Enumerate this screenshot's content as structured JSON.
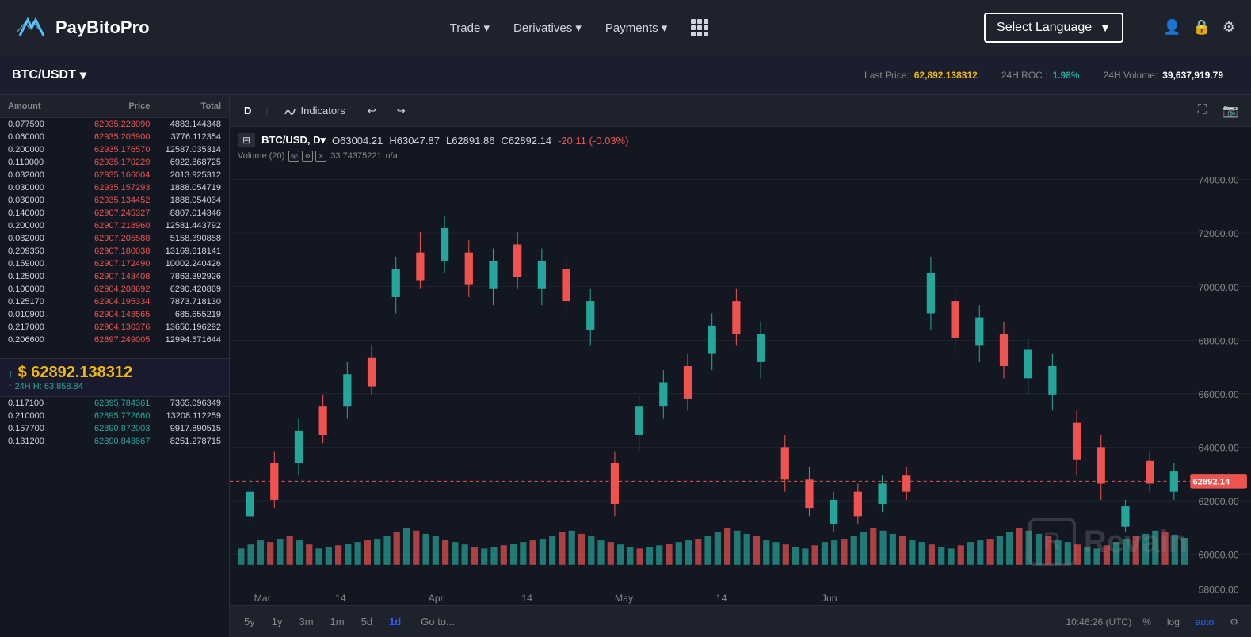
{
  "header": {
    "logo_text": "PayBitoPro",
    "nav": [
      {
        "label": "Trade ▾",
        "id": "trade"
      },
      {
        "label": "Derivatives ▾",
        "id": "derivatives"
      },
      {
        "label": "Payments ▾",
        "id": "payments"
      }
    ],
    "lang_button": "Select Language",
    "icons": [
      "👤",
      "🔒",
      "⚙"
    ]
  },
  "market_bar": {
    "pair": "BTC/USDT",
    "last_price_label": "Last Price:",
    "last_price": "62,892.138312",
    "roc_label": "24H ROC :",
    "roc_value": "1.98%",
    "volume_label": "24H Volume:",
    "volume_value": "39,637,919.79"
  },
  "chart": {
    "toolbar": {
      "timeframe": "D",
      "indicators": "Indicators",
      "undo": "↩",
      "redo": "↪"
    },
    "pair_info": {
      "symbol": "BTC/USD, D▾",
      "open_label": "O",
      "open_val": "63004.21",
      "high_label": "H",
      "high_val": "63047.87",
      "low_label": "L",
      "low_val": "62891.86",
      "close_label": "C",
      "close_val": "62892.14",
      "change": "-20.11 (-0.03%)"
    },
    "volume_info": {
      "label": "Volume (20)",
      "value": "33.74375221",
      "extra": "n/a"
    },
    "price_label": "62892.14",
    "price_levels": [
      "74000.00",
      "72000.00",
      "70000.00",
      "68000.00",
      "66000.00",
      "64000.00",
      "62000.00",
      "60000.00",
      "58000.00"
    ],
    "time_labels": [
      "Mar",
      "14",
      "Apr",
      "14",
      "May",
      "14",
      "Jun"
    ],
    "bottom_time": "10:46:26 (UTC)",
    "timeframes": [
      "5y",
      "1y",
      "3m",
      "1m",
      "5d",
      "1d"
    ],
    "goto": "Go to...",
    "right_controls": [
      "%",
      "log",
      "auto",
      "⚙"
    ]
  },
  "order_book": {
    "headers": [
      "Amount",
      "Price",
      "Total"
    ],
    "sell_rows": [
      {
        "amount": "0.077590",
        "price": "62935.228090",
        "total": "4883.144348"
      },
      {
        "amount": "0.060000",
        "price": "62935.205900",
        "total": "3776.112354"
      },
      {
        "amount": "0.200000",
        "price": "62935.176570",
        "total": "12587.035314"
      },
      {
        "amount": "0.110000",
        "price": "62935.170229",
        "total": "6922.868725"
      },
      {
        "amount": "0.032000",
        "price": "62935.166004",
        "total": "2013.925312"
      },
      {
        "amount": "0.030000",
        "price": "62935.157293",
        "total": "1888.054719"
      },
      {
        "amount": "0.030000",
        "price": "62935.134452",
        "total": "1888.054034"
      },
      {
        "amount": "0.140000",
        "price": "62907.245327",
        "total": "8807.014346"
      },
      {
        "amount": "0.200000",
        "price": "62907.218960",
        "total": "12581.443792"
      },
      {
        "amount": "0.082000",
        "price": "62907.205588",
        "total": "5158.390858"
      },
      {
        "amount": "0.209350",
        "price": "62907.180038",
        "total": "13169.618141"
      },
      {
        "amount": "0.159000",
        "price": "62907.172490",
        "total": "10002.240426"
      },
      {
        "amount": "0.125000",
        "price": "62907.143408",
        "total": "7863.392926"
      },
      {
        "amount": "0.100000",
        "price": "62904.208692",
        "total": "6290.420869"
      },
      {
        "amount": "0.125170",
        "price": "62904.195334",
        "total": "7873.718130"
      },
      {
        "amount": "0.010900",
        "price": "62904.148565",
        "total": "685.655219"
      },
      {
        "amount": "0.217000",
        "price": "62904.130376",
        "total": "13650.196292"
      },
      {
        "amount": "0.206600",
        "price": "62897.249005",
        "total": "12994.571644"
      }
    ],
    "current_price": "$ 62892.138312",
    "price_arrow": "↑",
    "price_high": "24H H: 63,858.84",
    "buy_rows": [
      {
        "amount": "0.117100",
        "price": "62895.784361",
        "total": "7365.096349"
      },
      {
        "amount": "0.210000",
        "price": "62895.772660",
        "total": "13208.112259"
      },
      {
        "amount": "0.157700",
        "price": "62890.872003",
        "total": "9917.890515"
      },
      {
        "amount": "0.131200",
        "price": "62890.843867",
        "total": "8251.278715"
      }
    ]
  }
}
